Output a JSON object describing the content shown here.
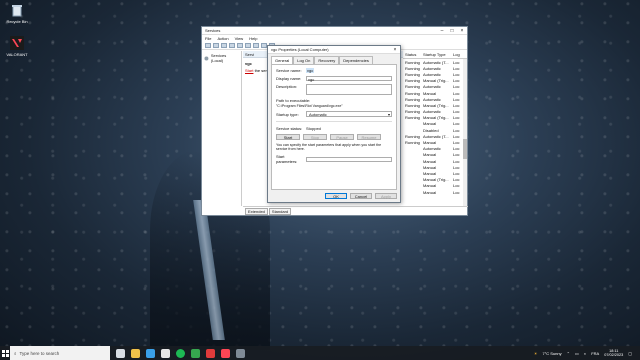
{
  "desktop": {
    "icons": [
      {
        "label": "Recycle Bin",
        "icon": "recycle-bin-icon"
      },
      {
        "label": "VALORANT",
        "icon": "valorant-icon"
      }
    ]
  },
  "services_window": {
    "title": "Services",
    "menu": [
      "File",
      "Action",
      "View",
      "Help"
    ],
    "tree_item": "Services (Local)",
    "middle_header": "Servi",
    "middle_title": "vgc",
    "middle_link_prefix": "Start",
    "middle_link_suffix": " the serv",
    "columns": {
      "status": "Status",
      "startup_type": "Startup Type",
      "log": "Log"
    },
    "rows": [
      {
        "status": "Running",
        "startup": "Automatic (T...",
        "log": "Loc"
      },
      {
        "status": "Running",
        "startup": "Automatic",
        "log": "Loc"
      },
      {
        "status": "Running",
        "startup": "Automatic",
        "log": "Loc"
      },
      {
        "status": "Running",
        "startup": "Manual (Trig...",
        "log": "Loc"
      },
      {
        "status": "Running",
        "startup": "Automatic",
        "log": "Loc"
      },
      {
        "status": "Running",
        "startup": "Manual",
        "log": "Loc"
      },
      {
        "status": "Running",
        "startup": "Automatic",
        "log": "Loc"
      },
      {
        "status": "Running",
        "startup": "Manual (Trig...",
        "log": "Loc"
      },
      {
        "status": "Running",
        "startup": "Automatic",
        "log": "Loc"
      },
      {
        "status": "Running",
        "startup": "Manual (Trig...",
        "log": "Loc"
      },
      {
        "status": "",
        "startup": "Manual",
        "log": "Loc"
      },
      {
        "status": "",
        "startup": "Disabled",
        "log": "Loc"
      },
      {
        "status": "Running",
        "startup": "Automatic (T...",
        "log": "Loc"
      },
      {
        "status": "Running",
        "startup": "Manual",
        "log": "Loc"
      },
      {
        "status": "",
        "startup": "Automatic",
        "log": "Loc"
      },
      {
        "status": "",
        "startup": "Manual",
        "log": "Loc"
      },
      {
        "status": "",
        "startup": "Manual",
        "log": "Loc"
      },
      {
        "status": "",
        "startup": "Manual",
        "log": "Loc"
      },
      {
        "status": "",
        "startup": "Manual",
        "log": "Loc"
      },
      {
        "status": "",
        "startup": "Manual (Trig...",
        "log": "Loc"
      },
      {
        "status": "",
        "startup": "Manual",
        "log": "Loc"
      },
      {
        "status": "",
        "startup": "Manual",
        "log": "Loc"
      }
    ],
    "bottom_tabs": [
      "Extended",
      "Standard"
    ]
  },
  "dialog": {
    "title": "vgc Properties (Local Computer)",
    "tabs": [
      "General",
      "Log On",
      "Recovery",
      "Dependencies"
    ],
    "service_name_label": "Service name:",
    "service_name": "vgc",
    "display_name_label": "Display name:",
    "display_name": "vgc",
    "description_label": "Description:",
    "path_label": "Path to executable:",
    "path_value": "\"C:\\Program Files\\Riot Vanguard\\vgc.exe\"",
    "startup_type_label": "Startup type:",
    "startup_type": "Automatic",
    "status_label": "Service status:",
    "status_value": "Stopped",
    "buttons": {
      "start": "Start",
      "stop": "Stop",
      "pause": "Pause",
      "resume": "Resume"
    },
    "note": "You can specify the start parameters that apply when you start the service from here.",
    "params_label": "Start parameters:",
    "footer": {
      "ok": "OK",
      "cancel": "Cancel",
      "apply": "Apply"
    }
  },
  "taskbar": {
    "search_placeholder": "Type here to search",
    "weather": "7°C  Sunny",
    "language": "FRA",
    "time": "18:11",
    "date": "07/02/2023"
  }
}
